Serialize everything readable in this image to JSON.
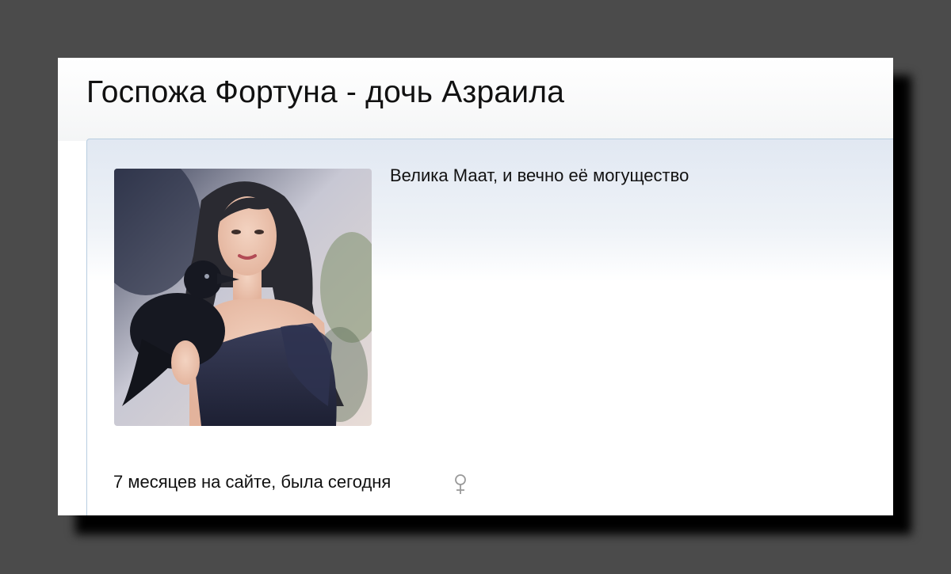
{
  "profile": {
    "name": "Госпожа Фортуна - дочь Азраила",
    "status_text": "Велика Маат, и вечно её могущество",
    "activity": "7 месяцев на сайте, была сегодня",
    "gender_icon": "female-symbol-icon",
    "avatar_description_icon": "avatar-image"
  },
  "colors": {
    "backdrop": "#4b4b4b",
    "card_border": "#b8cde0",
    "card_gradient_top": "#e1e8f2",
    "text": "#111111",
    "gender_icon": "#9a9a9a"
  }
}
